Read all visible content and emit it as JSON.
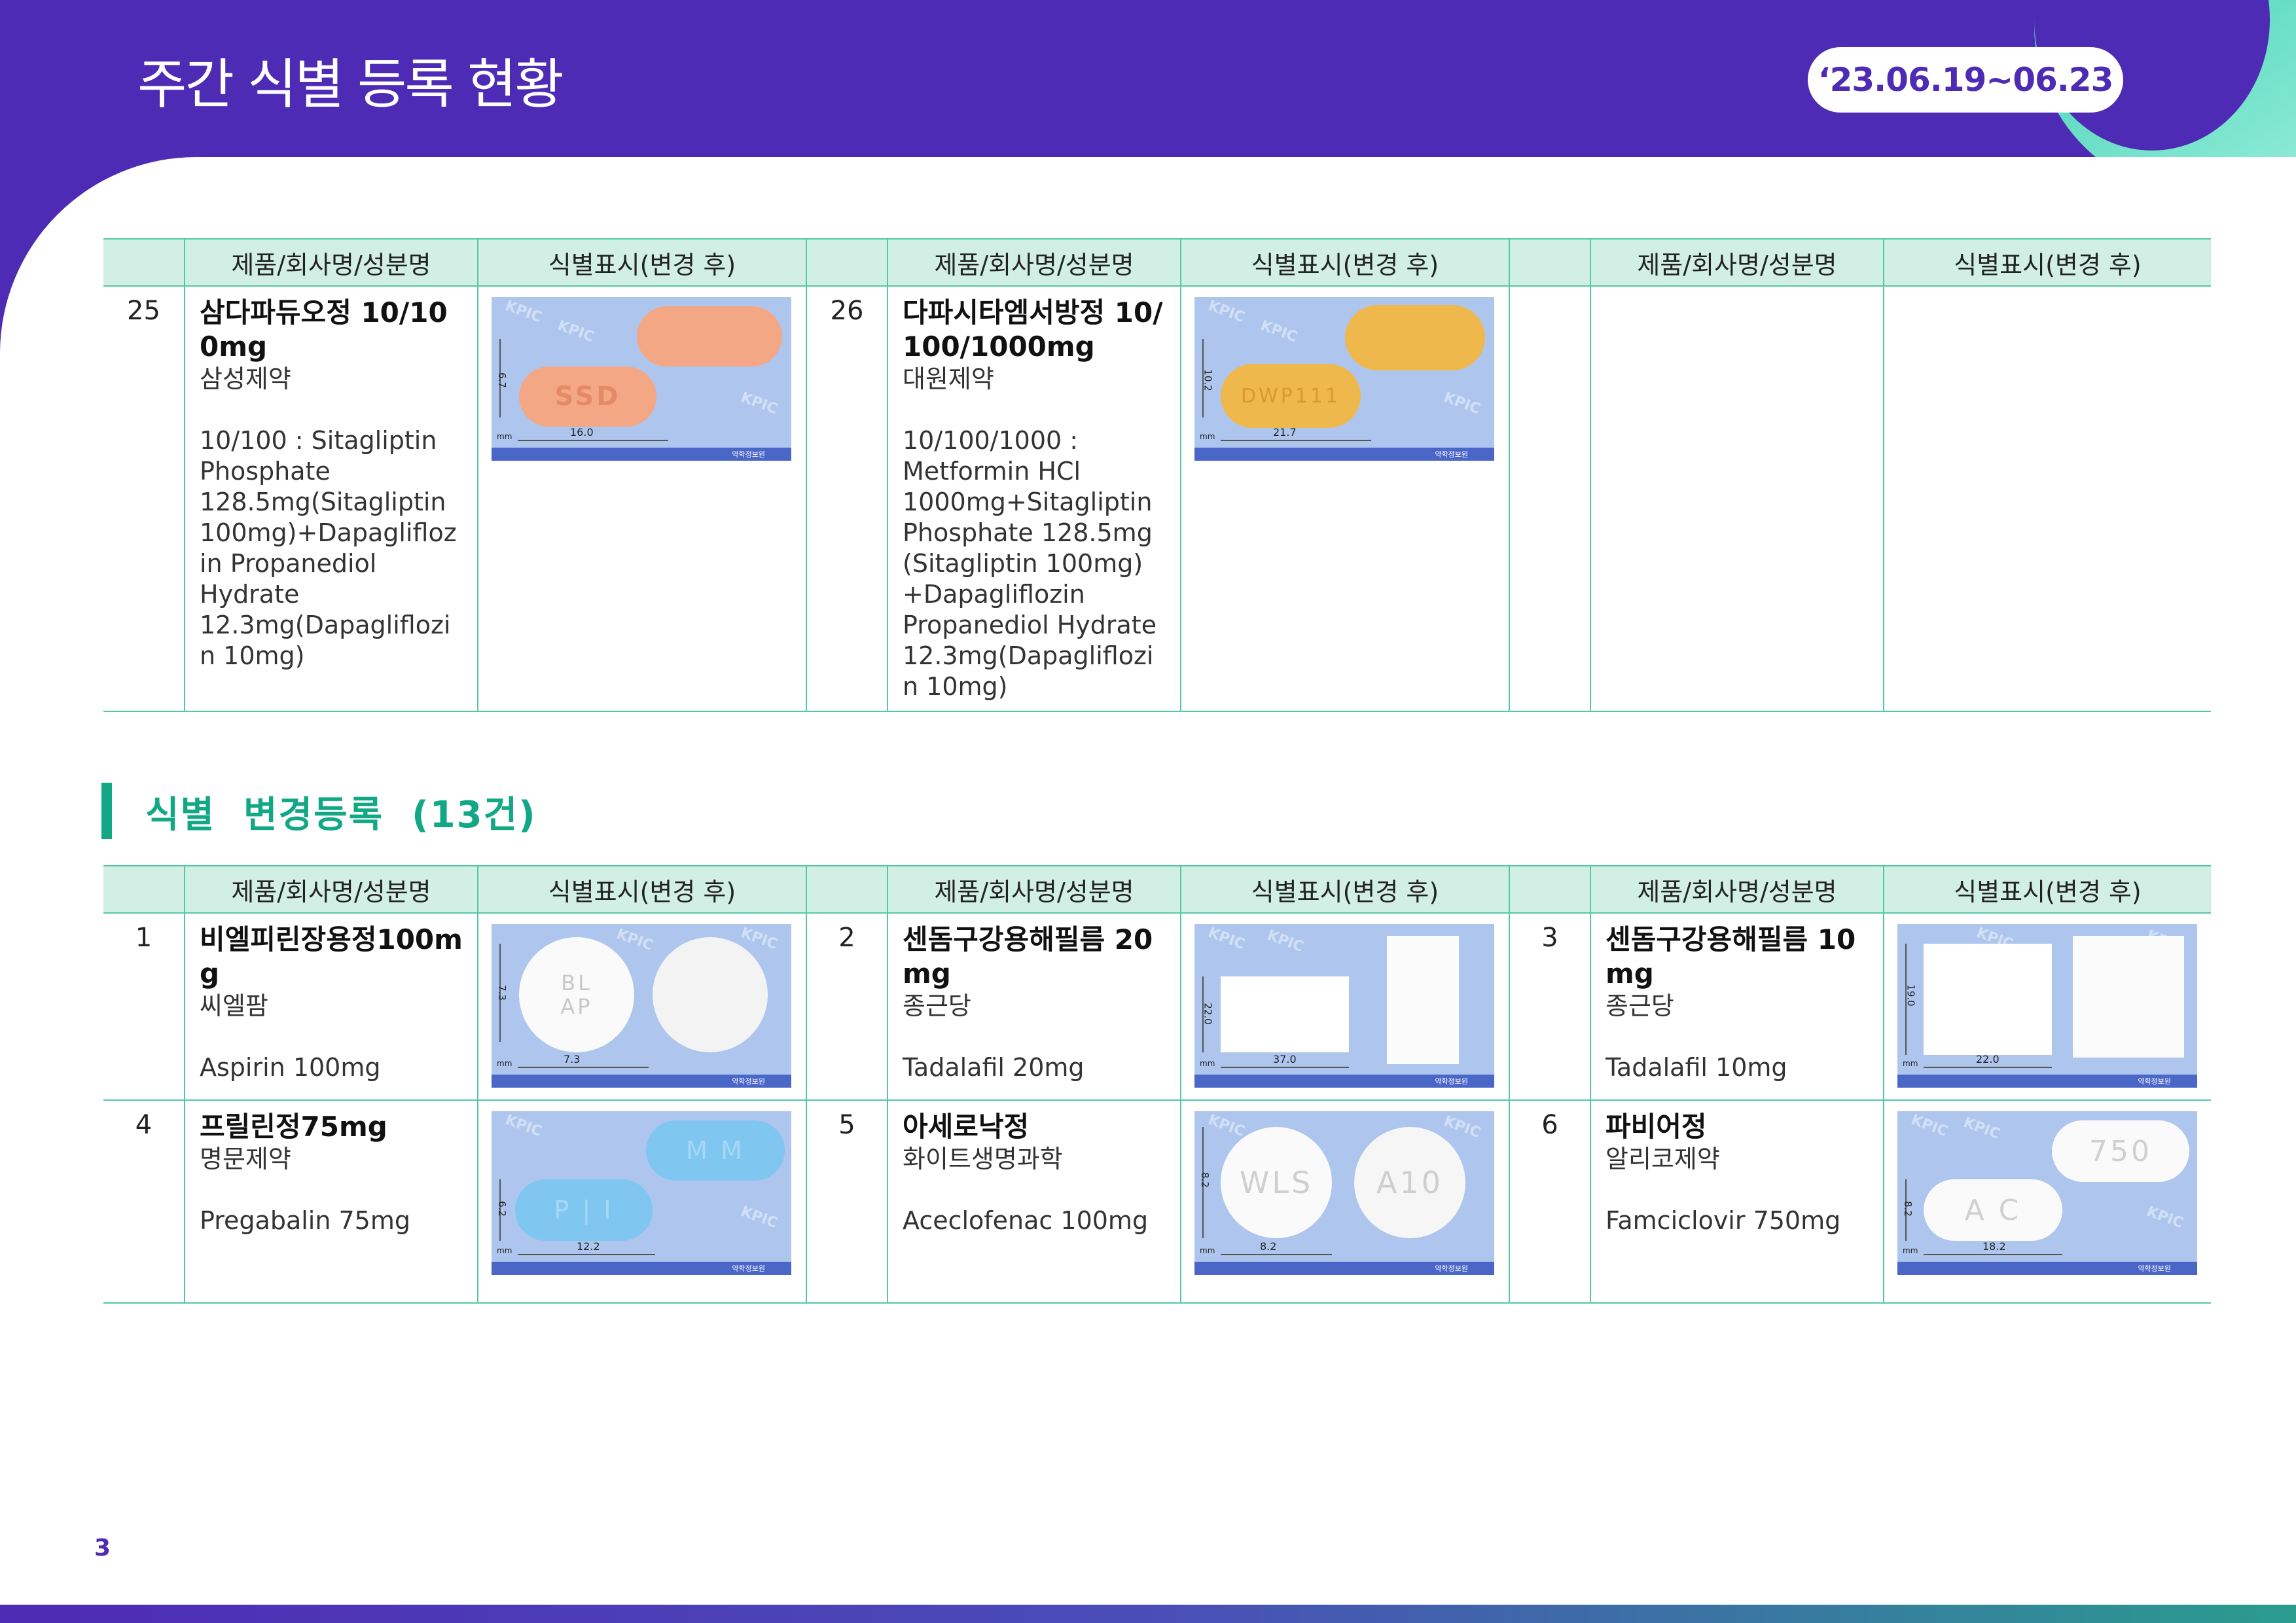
{
  "header": {
    "title": "주간 식별 등록 현황",
    "date_range": "‘23.06.19~06.23"
  },
  "columns": {
    "product": "제품/회사명/성분명",
    "marking": "식별표시(변경 후)"
  },
  "section": {
    "title": "식별  변경등록  (13건)"
  },
  "top_rows": [
    {
      "no": "25",
      "name": "삼다파듀오정 10/100mg",
      "company": "삼성제약",
      "ingredient": "10/100 : Sitagliptin Phosphate 128.5mg(Sitagliptin 100mg)+Dapagliflozin Propanediol Hydrate 12.3mg(Dapagliflozin 10mg)",
      "pill": {
        "imprint": "SSD",
        "color": "#f3a784",
        "h_scale": "16.0",
        "v_scale": "6.7"
      }
    },
    {
      "no": "26",
      "name": "다파시타엠서방정 10/100/1000mg",
      "company": "대원제약",
      "ingredient": "10/100/1000 : Metformin HCl 1000mg+Sitagliptin Phosphate 128.5mg (Sitagliptin 100mg) +Dapagliflozin Propanediol Hydrate 12.3mg(Dapagliflozin 10mg)",
      "pill": {
        "imprint": "DWP111",
        "color": "#efb84c",
        "h_scale": "21.7",
        "v_scale": "10.2"
      }
    }
  ],
  "bottom_rows": [
    [
      {
        "no": "1",
        "name": "비엘피린장용정100mg",
        "company": "씨엘팜",
        "ingredient": "Aspirin 100mg",
        "pill": {
          "imprint1": "BL",
          "imprint2": "AP",
          "color": "#fafafa",
          "h_scale": "7.3",
          "v_scale": "7.3"
        }
      },
      {
        "no": "2",
        "name": "센돔구강용해필름 20mg",
        "company": "종근당",
        "ingredient": "Tadalafil 20mg",
        "pill": {
          "color": "#ffffff",
          "h_scale": "37.0",
          "v_scale": "22.0"
        }
      },
      {
        "no": "3",
        "name": "센돔구강용해필름 10mg",
        "company": "종근당",
        "ingredient": "Tadalafil 10mg",
        "pill": {
          "color": "#ffffff",
          "h_scale": "22.0",
          "v_scale": "19.0"
        }
      }
    ],
    [
      {
        "no": "4",
        "name": "프릴린정75mg",
        "company": "명문제약",
        "ingredient": "Pregabalin 75mg",
        "pill": {
          "imprint1": "P | I",
          "imprint2": "M M",
          "color": "#7fc6f0",
          "h_scale": "12.2",
          "v_scale": "6.2"
        }
      },
      {
        "no": "5",
        "name": "아세로낙정",
        "company": "화이트생명과학",
        "ingredient": "Aceclofenac 100mg",
        "pill": {
          "imprint1": "WLS",
          "imprint2": "A10",
          "color": "#fafafa",
          "h_scale": "8.2",
          "v_scale": "8.2"
        }
      },
      {
        "no": "6",
        "name": "파비어정",
        "company": "알리코제약",
        "ingredient": "Famciclovir 750mg",
        "pill": {
          "imprint1": "A C",
          "imprint2": "750",
          "color": "#fafafa",
          "h_scale": "18.2",
          "v_scale": "8.2"
        }
      }
    ]
  ],
  "page_number": "3",
  "watermark": "KPIC",
  "image_footer": "약학정보원"
}
